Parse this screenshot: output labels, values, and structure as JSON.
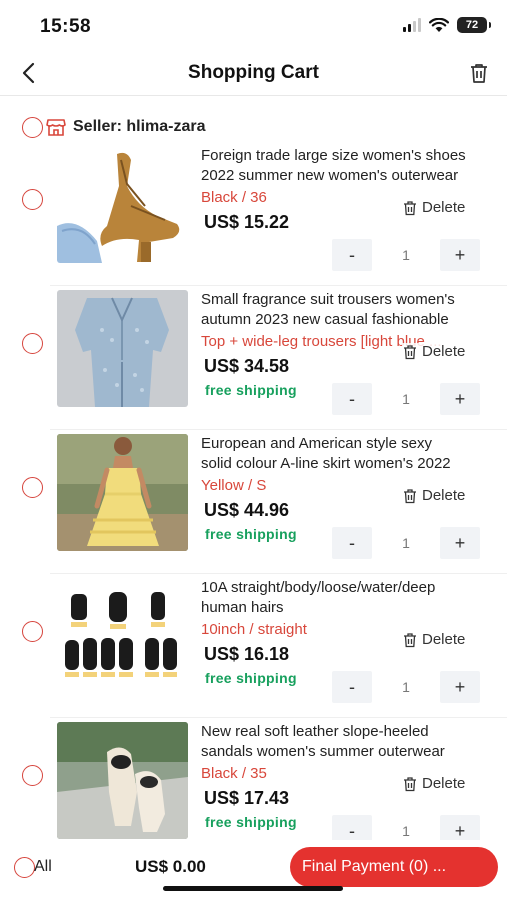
{
  "status_bar": {
    "time": "15:58",
    "battery": "72"
  },
  "header": {
    "title": "Shopping Cart",
    "back_icon": "chevron-left-icon",
    "trash_icon": "trash-icon"
  },
  "seller": {
    "label": "Seller: hlima-zara",
    "icon": "store-icon"
  },
  "items": [
    {
      "title_line1": "Foreign trade large size women's shoes",
      "title_line2": "2022 summer new women's outerwear",
      "variant": "Black / 36",
      "price": "US$ 15.22",
      "shipping": "",
      "delete_label": "Delete",
      "qty": "1"
    },
    {
      "title_line1": "Small fragrance suit trousers women's",
      "title_line2": "autumn 2023 new casual fashionable",
      "variant": "Top + wide-leg trousers [light blue ...",
      "price": "US$ 34.58",
      "shipping": "free shipping",
      "delete_label": "Delete",
      "qty": "1"
    },
    {
      "title_line1": "European and American style sexy",
      "title_line2": "solid colour A-line skirt women's 2022",
      "variant": "Yellow / S",
      "price": "US$ 44.96",
      "shipping": "free shipping",
      "delete_label": "Delete",
      "qty": "1"
    },
    {
      "title_line1": "10A straight/body/loose/water/deep",
      "title_line2": "human hairs",
      "variant": "10inch / straight",
      "price": "US$ 16.18",
      "shipping": "free shipping",
      "delete_label": "Delete",
      "qty": "1"
    },
    {
      "title_line1": "New real soft leather slope-heeled",
      "title_line2": "sandals women's summer outerwear",
      "variant": "Black / 35",
      "price": "US$ 17.43",
      "shipping": "free shipping",
      "delete_label": "Delete",
      "qty": "1"
    }
  ],
  "qty_controls": {
    "minus": "-",
    "plus": "+"
  },
  "bottom_bar": {
    "all_label": "All",
    "total": "US$ 0.00",
    "pay_label": "Final Payment  (0)  ..."
  },
  "colors": {
    "accent": "#e4322f",
    "variant": "#d8473b",
    "shipping": "#17a05d"
  }
}
